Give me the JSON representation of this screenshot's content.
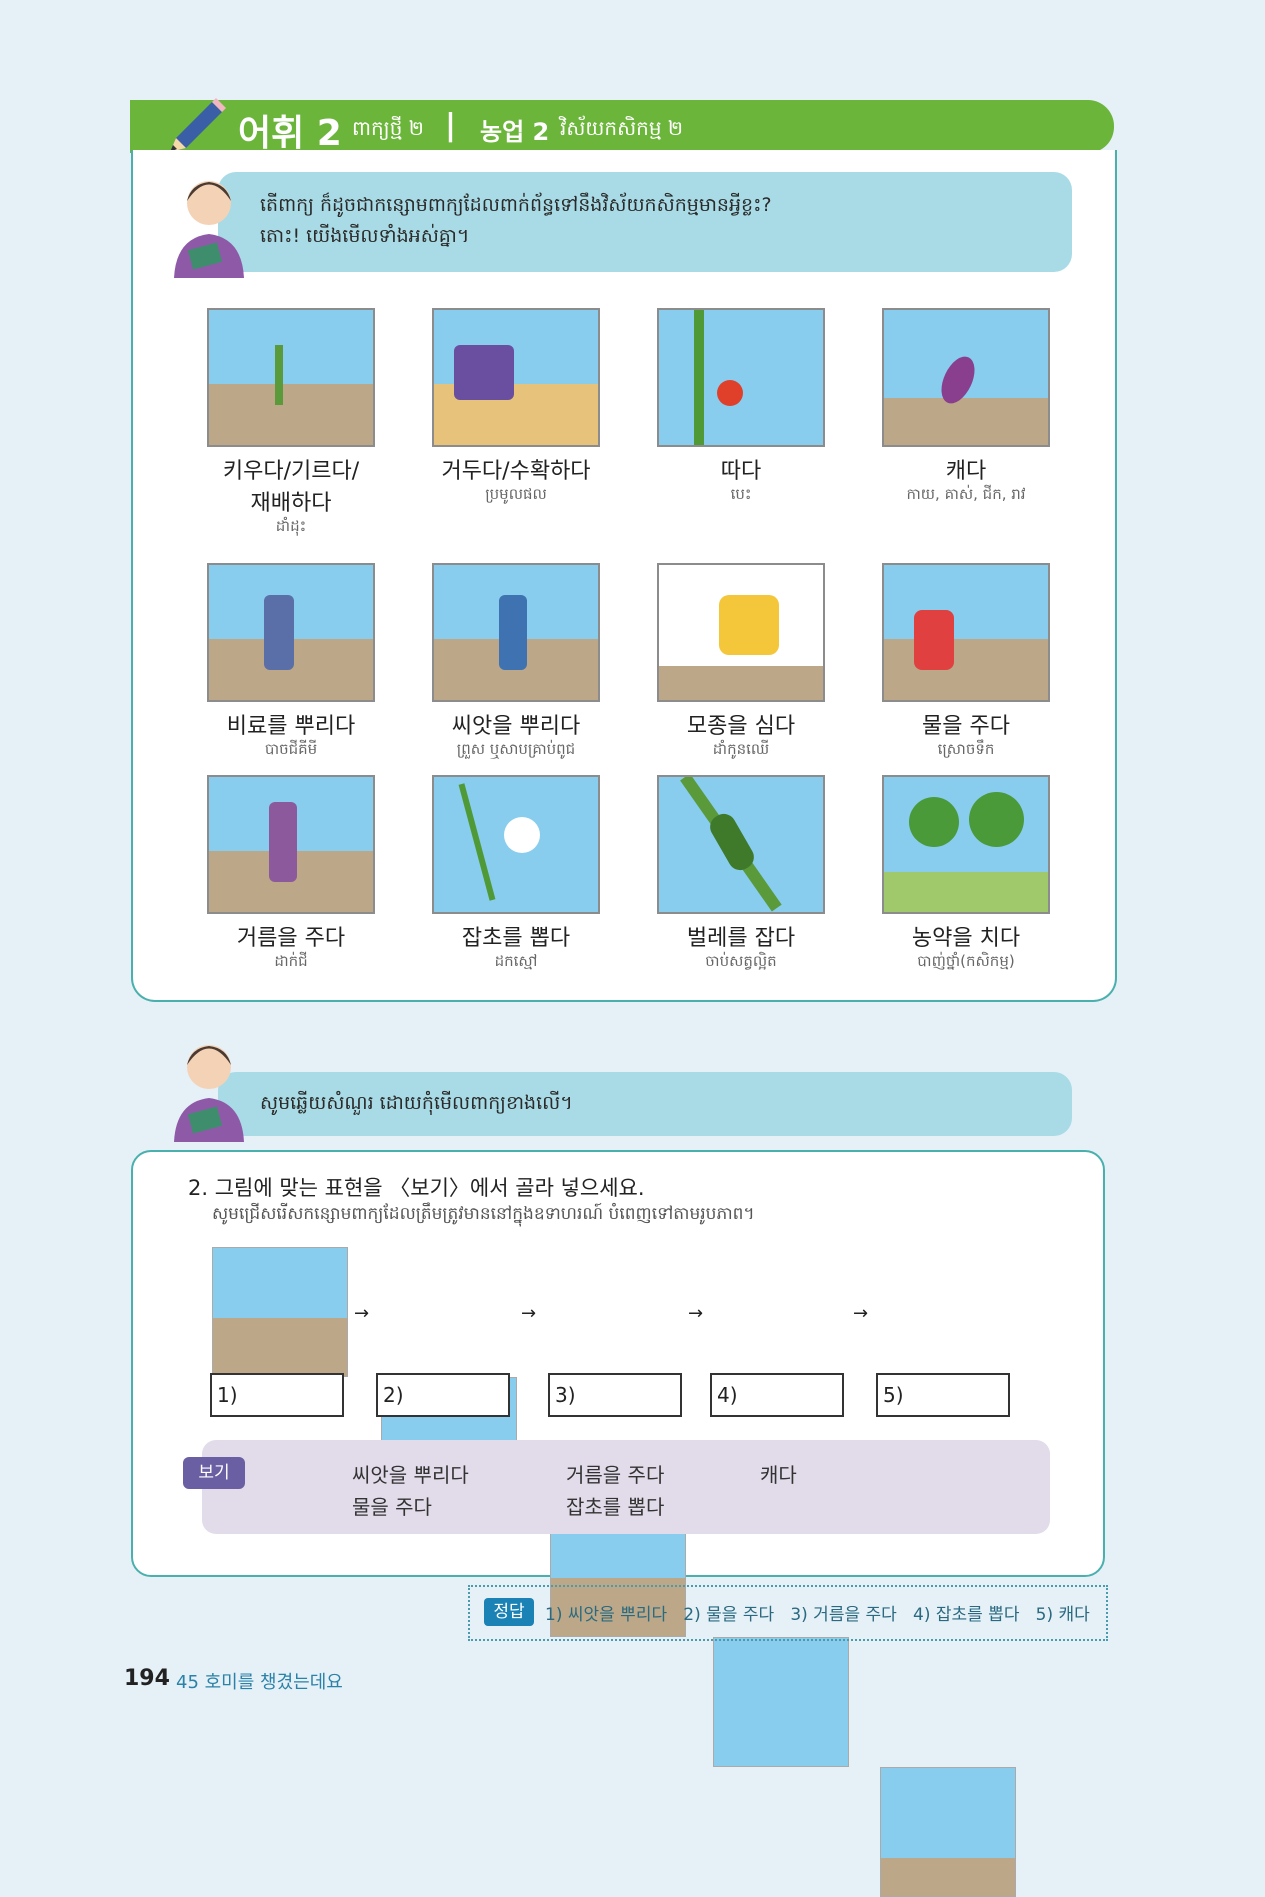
{
  "header": {
    "title": "어휘 2",
    "title_km": "ពាក្យថ្មី ២",
    "separator": "|",
    "subtitle": "농업 2",
    "subtitle_km": "វិស័យកសិកម្ម ២"
  },
  "intro": {
    "line1": "តើពាក្យ ក៏ដូចជាកន្សោមពាក្យដែលពាក់ព័ន្ធទៅនឹងវិស័យកសិកម្មមានអ្វីខ្លះ?",
    "line2": "តោះ! យើងមើលទាំងអស់គ្នា។"
  },
  "vocab": [
    {
      "ko": "키우다/기르다/",
      "ko2": "재배하다",
      "km": "ដាំដុះ"
    },
    {
      "ko": "거두다/수확하다",
      "ko2": "",
      "km": "ប្រមូលផល"
    },
    {
      "ko": "따다",
      "ko2": "",
      "km": "បេះ"
    },
    {
      "ko": "캐다",
      "ko2": "",
      "km": "កាយ, គាស់, ជីក, រាវ"
    },
    {
      "ko": "비료를 뿌리다",
      "ko2": "",
      "km": "បាចជីគីមី"
    },
    {
      "ko": "씨앗을 뿌리다",
      "ko2": "",
      "km": "ព្រួស ឬសាបគ្រាប់ពូជ"
    },
    {
      "ko": "모종을 심다",
      "ko2": "",
      "km": "ដាំកូនឈើ"
    },
    {
      "ko": "물을 주다",
      "ko2": "",
      "km": "ស្រោចទឹក"
    },
    {
      "ko": "거름을 주다",
      "ko2": "",
      "km": "ដាក់ជី"
    },
    {
      "ko": "잡초를 뽑다",
      "ko2": "",
      "km": "ដកស្មៅ"
    },
    {
      "ko": "벌레를 잡다",
      "ko2": "",
      "km": "ចាប់សត្វល្អិត"
    },
    {
      "ko": "농약을 치다",
      "ko2": "",
      "km": "បាញ់ថ្នាំ(កសិកម្ម)"
    }
  ],
  "intro2": "សូមឆ្លើយសំណួរ ដោយកុំមើលពាក្យខាងលើ។",
  "exercise": {
    "title": "2. 그림에 맞는 표현을 〈보기〉에서 골라 넣으세요.",
    "subtitle": "សូមជ្រើសរើសកន្សោមពាក្យដែលត្រឹមត្រូវមាននៅក្នុងឧទាហរណ៍ បំពេញទៅតាមរូបភាព។",
    "arrow": "→",
    "boxes": [
      "1)",
      "2)",
      "3)",
      "4)",
      "5)"
    ]
  },
  "bogi": {
    "tag": "보기",
    "words": [
      "씨앗을 뿌리다",
      "거름을 주다",
      "캐다",
      "물을 주다",
      "잡초를 뽑다"
    ]
  },
  "answer": {
    "tag": "정답",
    "text": "1) 씨앗을 뿌리다   2) 물을 주다   3) 거름을 주다   4) 잡초를 뽑다   5) 캐다"
  },
  "footer": {
    "page": "194",
    "chapter": "45 호미를 챙겼는데요"
  }
}
